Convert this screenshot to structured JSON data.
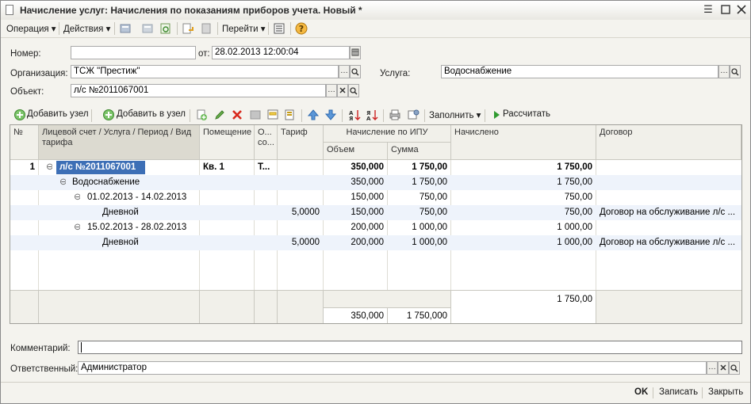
{
  "window": {
    "title": "Начисление услуг: Начисления по показаниям приборов учета. Новый *"
  },
  "menu": {
    "operation": "Операция",
    "actions": "Действия",
    "goto": "Перейти"
  },
  "form": {
    "number_label": "Номер:",
    "number_value": "",
    "from_label": "от:",
    "date_value": "28.02.2013 12:00:04",
    "org_label": "Организация:",
    "org_value": "ТСЖ \"Престиж\"",
    "service_label": "Услуга:",
    "service_value": "Водоснабжение",
    "object_label": "Объект:",
    "object_value": "л/с №2011067001"
  },
  "table_toolbar": {
    "add_node": "Добавить узел",
    "add_to_node": "Добавить в узел",
    "fill": "Заполнить",
    "calculate": "Рассчитать"
  },
  "table": {
    "headers": {
      "num": "№",
      "account": "Лицевой счет / Услуга / Период / Вид тарифа",
      "room": "Помещение",
      "o": "О... со...",
      "tariff": "Тариф",
      "ipu": "Начисление по ИПУ",
      "volume": "Объем",
      "sum": "Сумма",
      "accrued": "Начислено",
      "contract": "Договор"
    },
    "rows": [
      {
        "num": "1",
        "account": "л/с №2011067001",
        "room": "Кв. 1",
        "o": "Т...",
        "tariff": "",
        "volume": "350,000",
        "sum": "1 750,00",
        "accrued": "1 750,00",
        "contract": ""
      },
      {
        "num": "",
        "account": "Водоснабжение",
        "room": "",
        "o": "",
        "tariff": "",
        "volume": "350,000",
        "sum": "1 750,00",
        "accrued": "1 750,00",
        "contract": ""
      },
      {
        "num": "",
        "account": "01.02.2013 - 14.02.2013",
        "room": "",
        "o": "",
        "tariff": "",
        "volume": "150,000",
        "sum": "750,00",
        "accrued": "750,00",
        "contract": ""
      },
      {
        "num": "",
        "account": "Дневной",
        "room": "",
        "o": "",
        "tariff": "5,0000",
        "volume": "150,000",
        "sum": "750,00",
        "accrued": "750,00",
        "contract": "Договор на обслуживание л/с ..."
      },
      {
        "num": "",
        "account": "15.02.2013 - 28.02.2013",
        "room": "",
        "o": "",
        "tariff": "",
        "volume": "200,000",
        "sum": "1 000,00",
        "accrued": "1 000,00",
        "contract": ""
      },
      {
        "num": "",
        "account": "Дневной",
        "room": "",
        "o": "",
        "tariff": "5,0000",
        "volume": "200,000",
        "sum": "1 000,00",
        "accrued": "1 000,00",
        "contract": "Договор на обслуживание л/с ..."
      }
    ],
    "totals": {
      "accrued": "1 750,00",
      "volume": "350,000",
      "sum": "1 750,000"
    }
  },
  "bottom": {
    "comment_label": "Комментарий:",
    "comment_value": "",
    "responsible_label": "Ответственный:",
    "responsible_value": "Администратор"
  },
  "buttons": {
    "ok": "OK",
    "save": "Записать",
    "close": "Закрыть"
  },
  "colors": {
    "selection": "#3d6fb6",
    "band": "#eef3fb",
    "header": "#f1f0ea"
  }
}
